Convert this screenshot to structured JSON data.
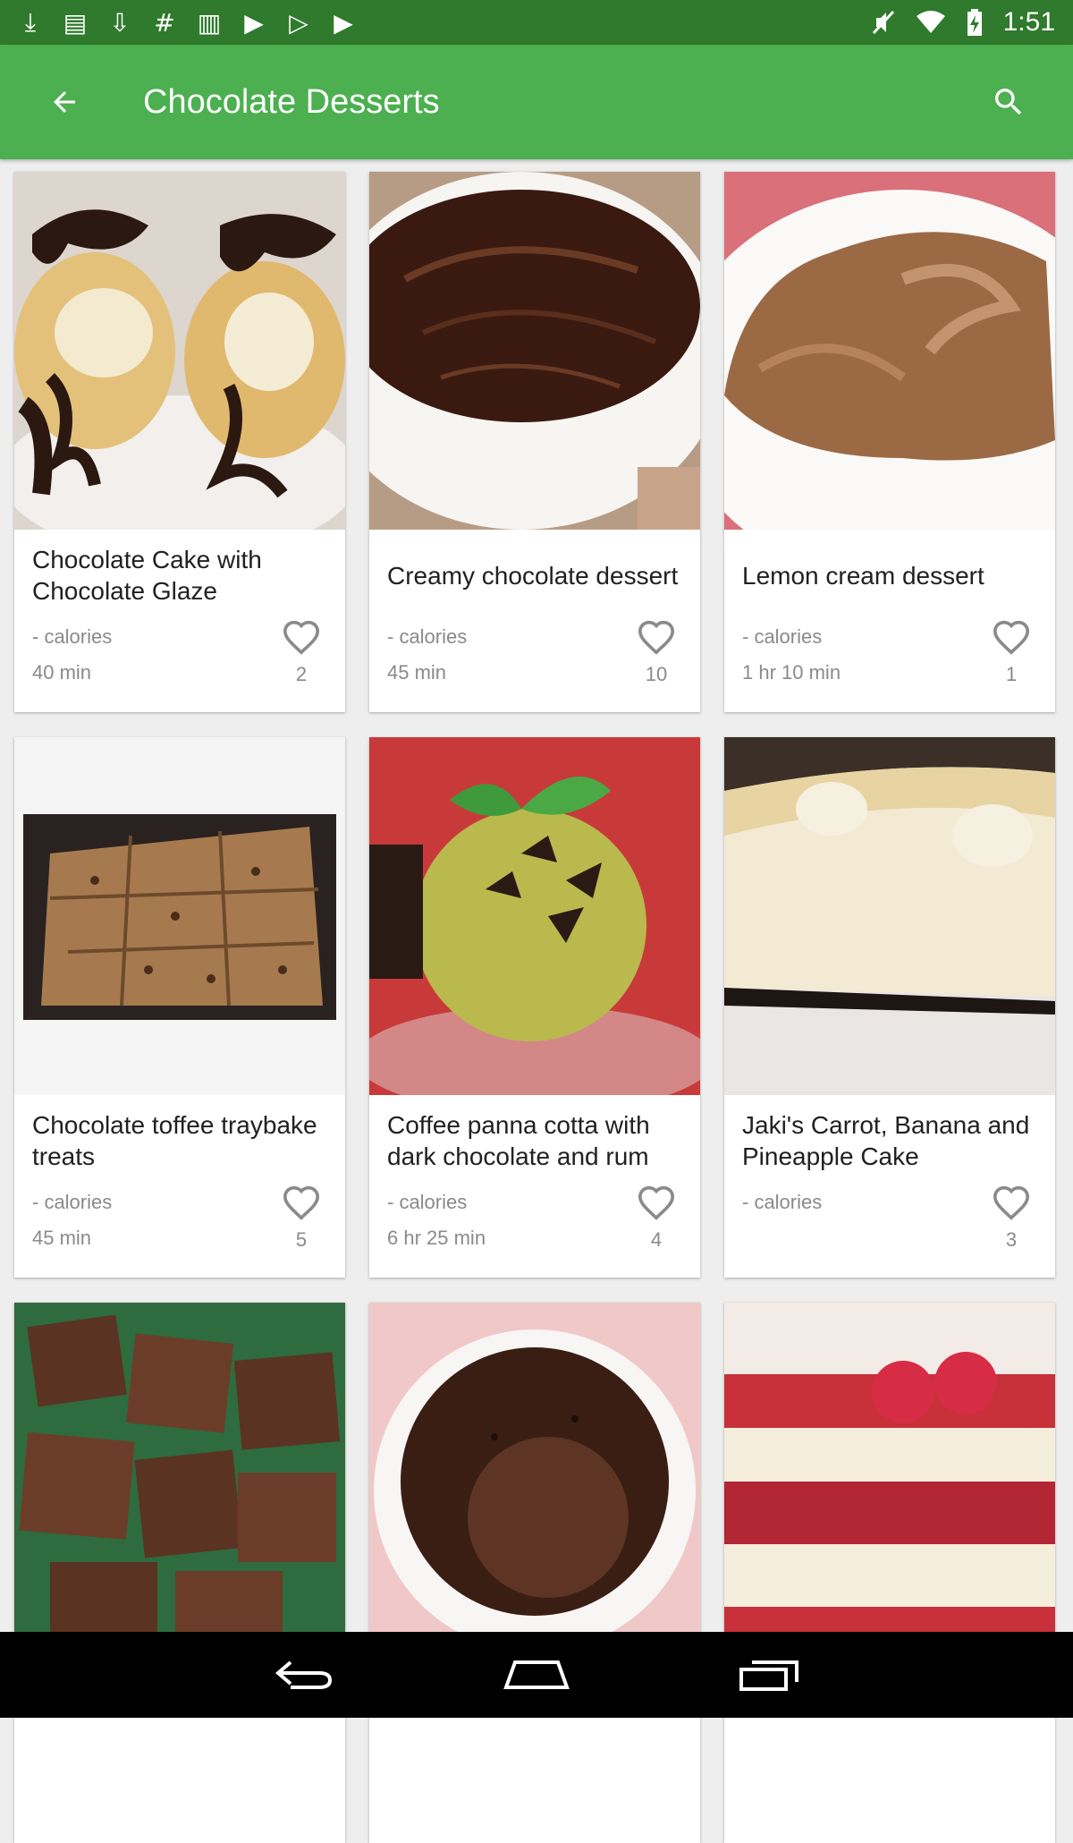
{
  "status_bar": {
    "time": "1:51",
    "left_icons": [
      "download-box-icon",
      "news-icon",
      "download-icon",
      "hashtag-icon",
      "barcode-icon",
      "play-store-icon",
      "play-store-icon",
      "youtube-icon"
    ],
    "right_icons": [
      "mute-icon",
      "wifi-icon",
      "battery-charging-icon"
    ]
  },
  "app_bar": {
    "title": "Chocolate Desserts",
    "bg_color": "#4caf50"
  },
  "recipes": [
    {
      "title": "Chocolate Cake with Chocolate Glaze",
      "calories": "- calories",
      "time": "40 min",
      "likes": "2",
      "image": "chocolate-drizzled-cream-puffs"
    },
    {
      "title": "Creamy chocolate dessert",
      "calories": "- calories",
      "time": "45 min",
      "likes": "10",
      "image": "chocolate-pudding-bowl"
    },
    {
      "title": "Lemon cream dessert",
      "calories": "- calories",
      "time": "1 hr 10 min",
      "likes": "1",
      "image": "mocha-mousse-bowl"
    },
    {
      "title": "Chocolate toffee traybake treats",
      "calories": "- calories",
      "time": "45 min",
      "likes": "5",
      "image": "toffee-traybake"
    },
    {
      "title": "Coffee panna cotta with dark chocolate and rum",
      "calories": "- calories",
      "time": "6 hr 25 min",
      "likes": "4",
      "image": "pistachio-ice-cream"
    },
    {
      "title": "Jaki's Carrot, Banana and Pineapple Cake",
      "calories": "- calories",
      "time": "",
      "likes": "3",
      "image": "banana-cream-pie-slice"
    },
    {
      "title": "",
      "calories": "",
      "time": "",
      "likes": "",
      "image": "chocolate-fudge-squares"
    },
    {
      "title": "",
      "calories": "",
      "time": "",
      "likes": "",
      "image": "chocolate-mug-cake"
    },
    {
      "title": "",
      "calories": "",
      "time": "",
      "likes": "",
      "image": "raspberry-parfait"
    }
  ],
  "nav_bar": {
    "icons": [
      "back-nav-icon",
      "home-nav-icon",
      "recents-nav-icon"
    ]
  }
}
